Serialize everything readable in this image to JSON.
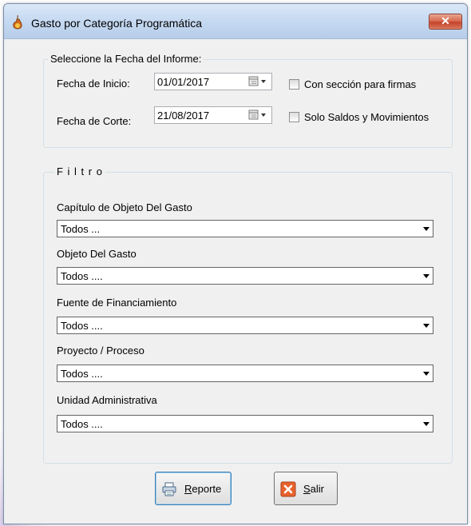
{
  "window": {
    "title": "Gasto por Categoría Programática",
    "close_label": "✕"
  },
  "date_group": {
    "legend": "Seleccione la Fecha del Informe:",
    "start_label": "Fecha de Inicio:",
    "start_value": "01/01/2017",
    "end_label": "Fecha de Corte:",
    "end_value": "21/08/2017",
    "signatures_label": "Con sección para firmas",
    "balances_label": "Solo Saldos y Movimientos"
  },
  "filter_group": {
    "legend": "F i l t r o",
    "fields": [
      {
        "label": "Capítulo de Objeto Del Gasto",
        "value": "Todos  ..."
      },
      {
        "label": "Objeto Del Gasto",
        "value": "Todos ...."
      },
      {
        "label": "Fuente de Financiamiento",
        "value": "Todos ...."
      },
      {
        "label": "Proyecto / Proceso",
        "value": "Todos ...."
      },
      {
        "label": "Unidad Administrativa",
        "value": "Todos ...."
      }
    ]
  },
  "buttons": {
    "report_mnemonic": "R",
    "report_rest": "eporte",
    "exit_mnemonic": "S",
    "exit_rest": "alir"
  },
  "icons": {
    "title": "app-flame-icon",
    "calendar": "calendar-dropdown-icon",
    "report": "printer-icon",
    "exit": "red-x-icon"
  }
}
